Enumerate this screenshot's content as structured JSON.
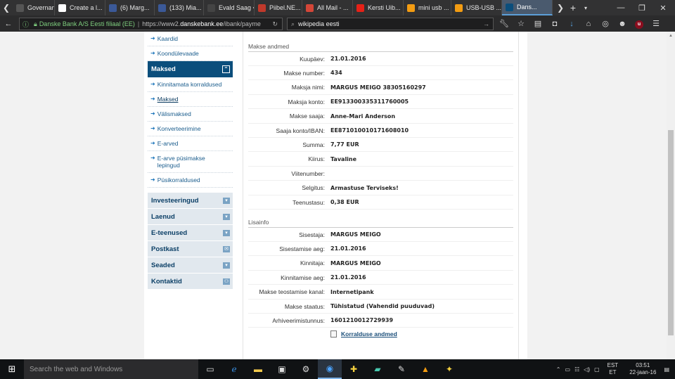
{
  "browser": {
    "tabs": [
      {
        "title": "Governan...",
        "color": "#555"
      },
      {
        "title": "Create a l...",
        "color": "#fff"
      },
      {
        "title": "(6) Marg...",
        "color": "#3b5998"
      },
      {
        "title": "(133) Mia...",
        "color": "#3b5998"
      },
      {
        "title": "Evald Saag < ...",
        "color": "#444"
      },
      {
        "title": "Piibel.NE...",
        "color": "#c0392b"
      },
      {
        "title": "All Mail - ...",
        "color": "#d44638"
      },
      {
        "title": "Kersti Uib...",
        "color": "#e62117"
      },
      {
        "title": "mini usb ...",
        "color": "#f39c12"
      },
      {
        "title": "USB-USB ...",
        "color": "#f39c12"
      },
      {
        "title": "Dans...",
        "color": "#0b4e7c"
      }
    ],
    "url_org": "Danske Bank A/S Eesti filiaal (EE)",
    "url_prefix": "https://www2.",
    "url_domain": "danskebank.ee",
    "url_path": "/ibank/payme",
    "search_value": "wikipedia eesti"
  },
  "sidebar": {
    "top_links": [
      "Kaardid",
      "Koondülevaade"
    ],
    "section_title": "Maksed",
    "section_links": [
      {
        "label": "Kinnitamata korraldused",
        "selected": false
      },
      {
        "label": "Maksed",
        "selected": true
      },
      {
        "label": "Välismaksed",
        "selected": false
      },
      {
        "label": "Konverteerimine",
        "selected": false
      },
      {
        "label": "E-arved",
        "selected": false
      },
      {
        "label": "E-arve püsimakse lepingud",
        "selected": false
      },
      {
        "label": "Püsikorraldused",
        "selected": false
      }
    ],
    "accordion": [
      {
        "label": "Investeeringud",
        "icon": "chevron-down-icon"
      },
      {
        "label": "Laenud",
        "icon": "chevron-down-icon"
      },
      {
        "label": "E-teenused",
        "icon": "chevron-down-icon"
      },
      {
        "label": "Postkast",
        "icon": "envelope-icon"
      },
      {
        "label": "Seaded",
        "icon": "chevron-down-icon"
      },
      {
        "label": "Kontaktid",
        "icon": "people-icon"
      }
    ]
  },
  "payment": {
    "section_title": "Makse andmed",
    "rows": [
      {
        "label": "Kuupäev:",
        "value": "21.01.2016"
      },
      {
        "label": "Makse number:",
        "value": "434"
      },
      {
        "label": "Maksja nimi:",
        "value": "MARGUS MEIGO 38305160297"
      },
      {
        "label": "Maksja konto:",
        "value": "EE913300335311760005"
      },
      {
        "label": "Makse saaja:",
        "value": "Anne-Mari Anderson"
      },
      {
        "label": "Saaja konto/IBAN:",
        "value": "EE871010010171608010"
      },
      {
        "label": "Summa:",
        "value": "7,77 EUR"
      },
      {
        "label": "Kiirus:",
        "value": "Tavaline"
      },
      {
        "label": "Viitenumber:",
        "value": ""
      },
      {
        "label": "Selgitus:",
        "value": "Armastuse Terviseks!"
      },
      {
        "label": "Teenustasu:",
        "value": "0,38 EUR"
      }
    ]
  },
  "extra": {
    "section_title": "Lisainfo",
    "rows": [
      {
        "label": "Sisestaja:",
        "value": "MARGUS MEIGO"
      },
      {
        "label": "Sisestamise aeg:",
        "value": "21.01.2016"
      },
      {
        "label": "Kinnitaja:",
        "value": "MARGUS MEIGO"
      },
      {
        "label": "Kinnitamise aeg:",
        "value": "21.01.2016"
      },
      {
        "label": "Makse teostamise kanal:",
        "value": "Internetipank"
      },
      {
        "label": "Makse staatus:",
        "value": "Tühistatud (Vahendid puuduvad)"
      },
      {
        "label": "Arhiveerimistunnus:",
        "value": "1601210012729939"
      }
    ],
    "print_link": "Korralduse andmed"
  },
  "taskbar": {
    "search_placeholder": "Search the web and Windows",
    "lang_top": "EST",
    "lang_bottom": "ET",
    "time": "03:51",
    "date": "22-jaan-16"
  }
}
